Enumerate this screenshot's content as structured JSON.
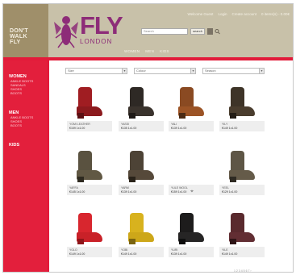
{
  "brand": {
    "corner_lines": [
      "DON'T",
      "WALK",
      "FLY"
    ],
    "logo_word": "FLY",
    "logo_sub": "LONDON"
  },
  "top_links": [
    "Welcome Guest",
    "Login",
    "Create account",
    "0 items(s) - 0.00€"
  ],
  "search": {
    "placeholder": "Search",
    "button": "search"
  },
  "main_nav": [
    "WOMEN",
    "MEN",
    "KIDS"
  ],
  "sidebar": {
    "sections": [
      {
        "title": "WOMEN",
        "items": [
          "ANKLE BOOTS",
          "SANDALS",
          "SHOES",
          "BOOTS"
        ]
      },
      {
        "title": "MEN",
        "items": [
          "ANKLE BOOTS",
          "SHOES",
          "BOOTS"
        ]
      },
      {
        "title": "KIDS",
        "items": []
      }
    ]
  },
  "filters": [
    {
      "value": "Size"
    },
    {
      "value": "Colour"
    },
    {
      "value": "Season"
    }
  ],
  "products": [
    {
      "name": "YOMI LEATHER",
      "price": "€159 1x1.00",
      "colors": {
        "shaft": "#a01d22",
        "foot": "#8c1a1e",
        "heel": "#5a1013"
      }
    },
    {
      "name": "YASSI",
      "price": "€135 1x1.00",
      "colors": {
        "shaft": "#2e2925",
        "foot": "#3a332d",
        "heel": "#1e1a17"
      }
    },
    {
      "name": "YALI",
      "price": "€139 1x1.00",
      "colors": {
        "shaft": "#8a4a22",
        "foot": "#9c5426",
        "heel": "#4a2a14"
      }
    },
    {
      "name": "YILY",
      "price": "€149 1x1.00",
      "colors": {
        "shaft": "#3e3428",
        "foot": "#4a3d2e",
        "heel": "#231c15"
      }
    },
    {
      "name": "YAFFA",
      "price": "€145 1x1.00",
      "colors": {
        "shaft": "#5a5240",
        "foot": "#615844",
        "heel": "#2e2a20"
      }
    },
    {
      "name": "YARM",
      "price": "€139 1x1.00",
      "colors": {
        "shaft": "#4d4336",
        "foot": "#56493a",
        "heel": "#2a231a"
      }
    },
    {
      "name": "YULE WOOL",
      "price": "€159 1x1.00",
      "colors": {
        "shaft": "#ffffff",
        "foot": "#ffffff",
        "heel": "#ffffff"
      }
    },
    {
      "name": "YEEL",
      "price": "€129 1x1.00",
      "colors": {
        "shaft": "#5e5646",
        "foot": "#655b49",
        "heel": "#2f2b23"
      }
    },
    {
      "name": "YOLO",
      "price": "€149 1x1.00",
      "colors": {
        "shaft": "#d8262e",
        "foot": "#c92128",
        "heel": "#8e1519"
      }
    },
    {
      "name": "YOBI",
      "price": "€149 1x1.00",
      "colors": {
        "shaft": "#d8b21e",
        "foot": "#cda719",
        "heel": "#7a6410"
      }
    },
    {
      "name": "YURI",
      "price": "€139 1x1.00",
      "colors": {
        "shaft": "#1d1c1c",
        "foot": "#262525",
        "heel": "#0e0e0e"
      }
    },
    {
      "name": "YILE",
      "price": "€149 1x1.00",
      "colors": {
        "shaft": "#5a2a2e",
        "foot": "#622e33",
        "heel": "#2e1416"
      }
    }
  ],
  "pager": "1 2 3 4 5 6 7 ›"
}
